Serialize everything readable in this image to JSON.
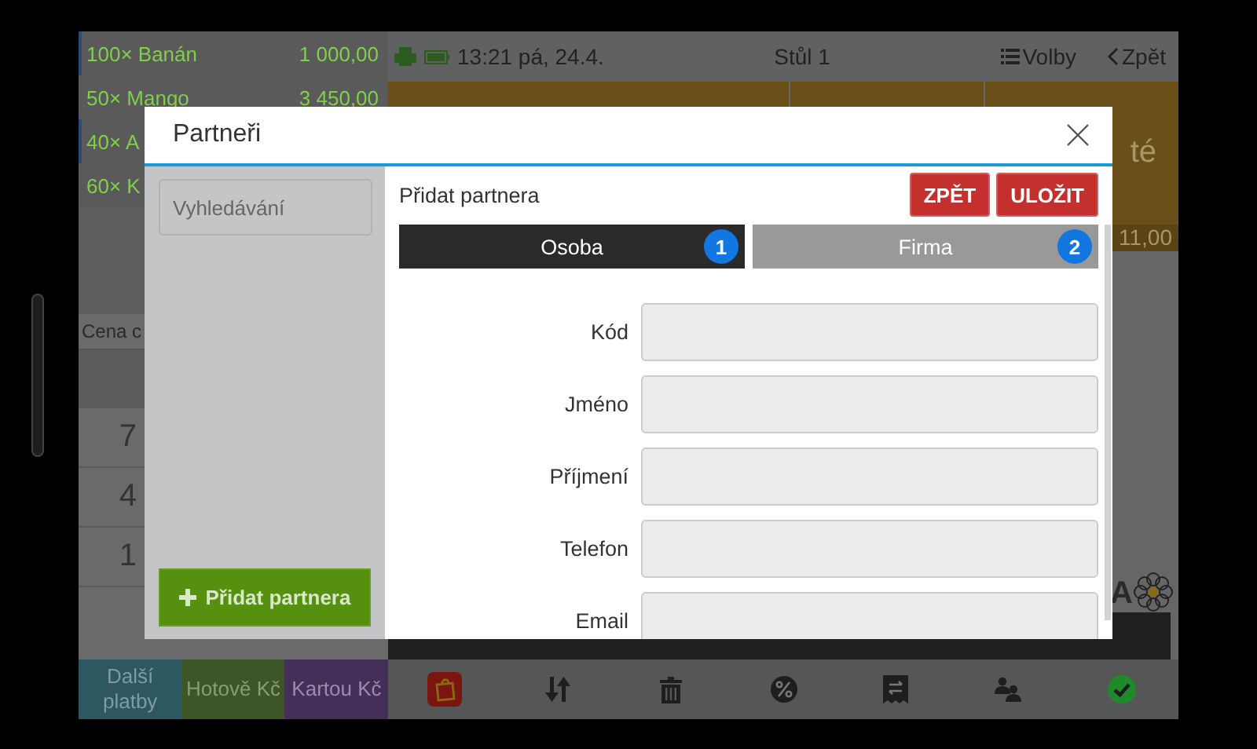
{
  "status_bar": {
    "time": "13:21 pá, 24.4.",
    "table": "Stůl 1",
    "options": "Volby",
    "back": "Zpět"
  },
  "order_items": [
    {
      "name": "100× Banán",
      "price": "1 000,00",
      "selected": true
    },
    {
      "name": "50× Mango",
      "price": "3 450,00",
      "selected": false
    },
    {
      "name": "40× A",
      "selected": true
    },
    {
      "name": "60× K",
      "selected": false
    }
  ],
  "price_label": "Cena c",
  "keypad": [
    "7",
    "4",
    "1"
  ],
  "product_tile": {
    "label": "té",
    "price": "11,00"
  },
  "logo_fragment": "A",
  "payment_buttons": [
    {
      "label": "Další platby",
      "color": "#2d5862"
    },
    {
      "label": "Hotově Kč",
      "color": "#3d5628"
    },
    {
      "label": "Kartou Kč",
      "color": "#432f58"
    }
  ],
  "dialog": {
    "title": "Partneři",
    "search": {
      "placeholder": "Vyhledávání"
    },
    "add_button": "Přidat partnera",
    "form_title": "Přidat partnera",
    "buttons": [
      "ZPĚT",
      "ULOŽIT"
    ],
    "tabs": [
      {
        "label": "Osoba",
        "badge": "1",
        "selected": true
      },
      {
        "label": "Firma",
        "badge": "2",
        "selected": false
      }
    ],
    "fields": [
      {
        "label": "Kód"
      },
      {
        "label": "Jméno"
      },
      {
        "label": "Příjmení"
      },
      {
        "label": "Telefon"
      },
      {
        "label": "Email"
      }
    ]
  }
}
